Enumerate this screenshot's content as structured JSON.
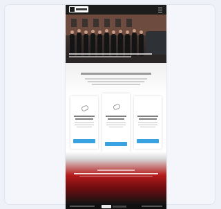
{
  "site": {
    "logo_text": "",
    "hero_caption": "",
    "intro_title": "",
    "features": [
      {
        "title": "",
        "button": ""
      },
      {
        "title": "",
        "button": ""
      },
      {
        "title": "",
        "button": ""
      }
    ],
    "band_title": "",
    "band_text": ""
  },
  "colors": {
    "accent_blue": "#3aa2e0",
    "band_red": "#b51a1a",
    "nav_dark": "#1c1c1c"
  },
  "icons": {
    "menu": "hamburger-menu-icon",
    "feature": "pill-icon"
  }
}
